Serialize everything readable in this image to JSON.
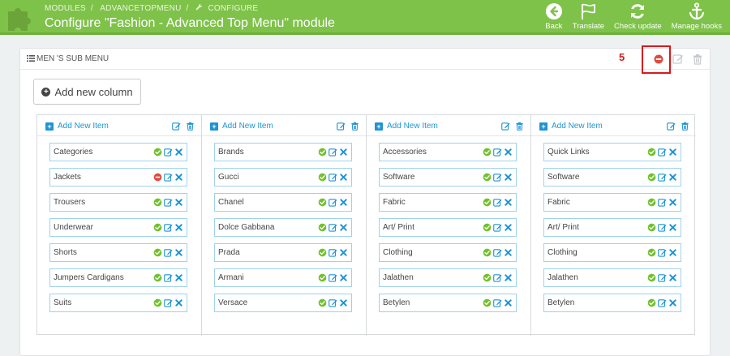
{
  "header": {
    "breadcrumb": [
      "MODULES",
      "ADVANCETOPMENU",
      "CONFIGURE"
    ],
    "title": "Configure \"Fashion - Advanced Top Menu\" module",
    "toolbar": [
      {
        "label": "Back",
        "icon": "back-arrow-icon"
      },
      {
        "label": "Translate",
        "icon": "flag-icon"
      },
      {
        "label": "Check update",
        "icon": "refresh-icon"
      },
      {
        "label": "Manage hooks",
        "icon": "anchor-icon"
      }
    ]
  },
  "panel": {
    "title": "MEN 'S SUB MENU",
    "annotation_number": "5",
    "add_column_label": "Add new column"
  },
  "columns": [
    {
      "add_item_label": "Add New Item",
      "items": [
        {
          "label": "Categories",
          "status": "enabled"
        },
        {
          "label": "Jackets",
          "status": "disabled"
        },
        {
          "label": "Trousers",
          "status": "enabled"
        },
        {
          "label": "Underwear",
          "status": "enabled"
        },
        {
          "label": "Shorts",
          "status": "enabled"
        },
        {
          "label": "Jumpers Cardigans",
          "status": "enabled"
        },
        {
          "label": "Suits",
          "status": "enabled"
        }
      ]
    },
    {
      "add_item_label": "Add New Item",
      "items": [
        {
          "label": "Brands",
          "status": "enabled"
        },
        {
          "label": "Gucci",
          "status": "enabled"
        },
        {
          "label": "Chanel",
          "status": "enabled"
        },
        {
          "label": "Dolce Gabbana",
          "status": "enabled"
        },
        {
          "label": "Prada",
          "status": "enabled"
        },
        {
          "label": "Armani",
          "status": "enabled"
        },
        {
          "label": "Versace",
          "status": "enabled"
        }
      ]
    },
    {
      "add_item_label": "Add New Item",
      "items": [
        {
          "label": "Accessories",
          "status": "enabled"
        },
        {
          "label": "Software",
          "status": "enabled"
        },
        {
          "label": "Fabric",
          "status": "enabled"
        },
        {
          "label": "Art/ Print",
          "status": "enabled"
        },
        {
          "label": "Clothing",
          "status": "enabled"
        },
        {
          "label": "Jalathen",
          "status": "enabled"
        },
        {
          "label": "Betylen",
          "status": "enabled"
        }
      ]
    },
    {
      "add_item_label": "Add New Item",
      "items": [
        {
          "label": "Quick Links",
          "status": "enabled"
        },
        {
          "label": "Software",
          "status": "enabled"
        },
        {
          "label": "Fabric",
          "status": "enabled"
        },
        {
          "label": "Art/ Print",
          "status": "enabled"
        },
        {
          "label": "Clothing",
          "status": "enabled"
        },
        {
          "label": "Jalathen",
          "status": "enabled"
        },
        {
          "label": "Betylen",
          "status": "enabled"
        }
      ]
    }
  ],
  "colors": {
    "header_green": "#7fc24a",
    "accent_blue": "#1e94d4",
    "enabled_green": "#72c12d",
    "disabled_red": "#e04b3f",
    "annotation_red": "#d9191c"
  }
}
